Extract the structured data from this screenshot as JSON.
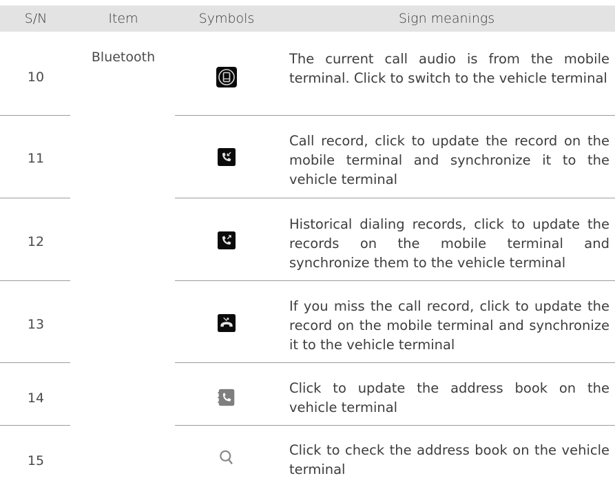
{
  "header": {
    "sn": "S/N",
    "item": "Item",
    "symbols": "Symbols",
    "meanings": "Sign meanings"
  },
  "group_item": "Bluetooth",
  "rows": [
    {
      "sn": "10",
      "icon": "mobile-terminal-audio-icon",
      "meaning": "The current call audio is from the mobile terminal. Click to switch to the vehicle terminal"
    },
    {
      "sn": "11",
      "icon": "incoming-call-record-icon",
      "meaning": "Call record, click to update the record on the mobile terminal and synchronize it to the vehicle terminal"
    },
    {
      "sn": "12",
      "icon": "outgoing-call-record-icon",
      "meaning": "Historical dialing records, click to update the records on the mobile terminal and synchronize them to the vehicle terminal"
    },
    {
      "sn": "13",
      "icon": "missed-call-icon",
      "meaning": "If you miss the call record, click to update the record on the mobile terminal and synchronize it to the vehicle terminal"
    },
    {
      "sn": "14",
      "icon": "address-book-update-icon",
      "meaning": "Click to update the address book on the vehicle terminal"
    },
    {
      "sn": "15",
      "icon": "search-icon",
      "meaning": "Click to check the address book on the vehicle terminal"
    }
  ]
}
